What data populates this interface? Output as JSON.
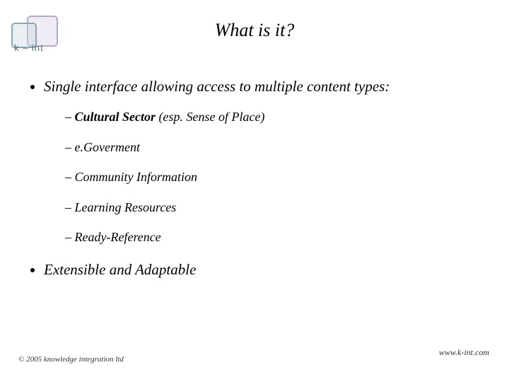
{
  "logo": {
    "k": "k",
    "dash": "–",
    "int": "int"
  },
  "title": "What is it?",
  "bullets": {
    "main1": "Single interface allowing access to multiple content types:",
    "sub": [
      {
        "bold": "Cultural Sector",
        "rest": " (esp. Sense of Place)"
      },
      {
        "bold": "",
        "rest": "e.Goverment"
      },
      {
        "bold": "",
        "rest": "Community Information"
      },
      {
        "bold": "",
        "rest": "Learning Resources"
      },
      {
        "bold": "",
        "rest": "Ready-Reference"
      }
    ],
    "main2": "Extensible and Adaptable"
  },
  "footer": {
    "left": "© 2005 knowledge integration ltd",
    "right": "www.k-int.com"
  }
}
